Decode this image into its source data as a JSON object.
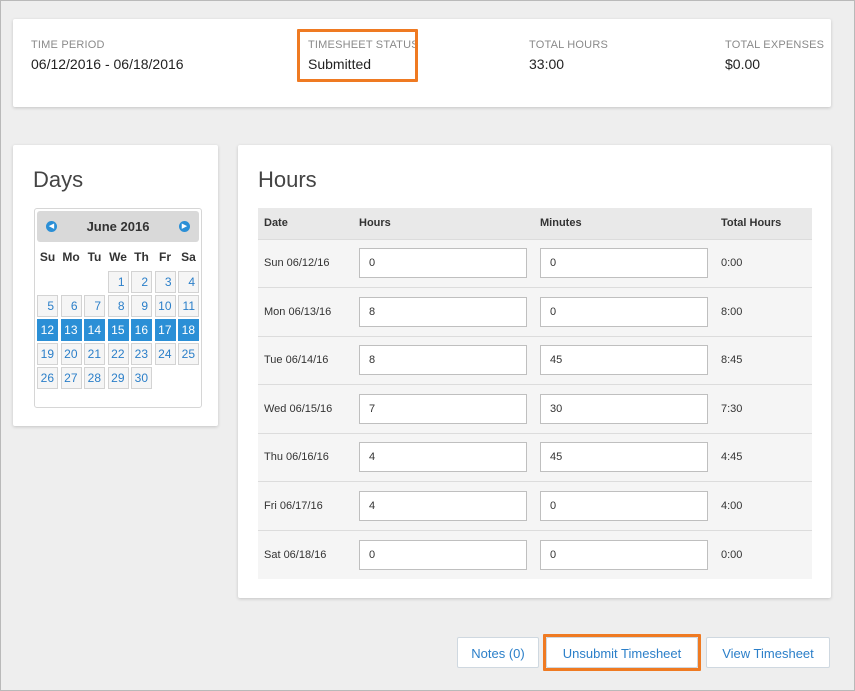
{
  "summary": {
    "time_period_label": "TIME PERIOD",
    "time_period_value": "06/12/2016 - 06/18/2016",
    "status_label": "TIMESHEET STATUS",
    "status_value": "Submitted",
    "total_hours_label": "TOTAL HOURS",
    "total_hours_value": "33:00",
    "total_expenses_label": "TOTAL EXPENSES",
    "total_expenses_value": "$0.00"
  },
  "days": {
    "title": "Days",
    "calendar": {
      "month": "June 2016",
      "prev_icon": "chevron-left-icon",
      "next_icon": "chevron-right-icon",
      "weekdays": [
        "Su",
        "Mo",
        "Tu",
        "We",
        "Th",
        "Fr",
        "Sa"
      ],
      "leading_blanks": 3,
      "days": [
        "1",
        "2",
        "3",
        "4",
        "5",
        "6",
        "7",
        "8",
        "9",
        "10",
        "11",
        "12",
        "13",
        "14",
        "15",
        "16",
        "17",
        "18",
        "19",
        "20",
        "21",
        "22",
        "23",
        "24",
        "25",
        "26",
        "27",
        "28",
        "29",
        "30"
      ],
      "selected": [
        "12",
        "13",
        "14",
        "15",
        "16",
        "17",
        "18"
      ]
    }
  },
  "hours": {
    "title": "Hours",
    "columns": [
      "Date",
      "Hours",
      "Minutes",
      "Total Hours"
    ],
    "rows": [
      {
        "date": "Sun 06/12/16",
        "hours": "0",
        "minutes": "0",
        "total": "0:00"
      },
      {
        "date": "Mon 06/13/16",
        "hours": "8",
        "minutes": "0",
        "total": "8:00"
      },
      {
        "date": "Tue 06/14/16",
        "hours": "8",
        "minutes": "45",
        "total": "8:45"
      },
      {
        "date": "Wed 06/15/16",
        "hours": "7",
        "minutes": "30",
        "total": "7:30"
      },
      {
        "date": "Thu 06/16/16",
        "hours": "4",
        "minutes": "45",
        "total": "4:45"
      },
      {
        "date": "Fri 06/17/16",
        "hours": "4",
        "minutes": "0",
        "total": "4:00"
      },
      {
        "date": "Sat 06/18/16",
        "hours": "0",
        "minutes": "0",
        "total": "0:00"
      }
    ]
  },
  "actions": {
    "notes_label": "Notes (0)",
    "unsubmit_label": "Unsubmit Timesheet",
    "view_label": "View Timesheet"
  },
  "colors": {
    "highlight": "#ef7a22",
    "accent": "#2b8fd6"
  }
}
